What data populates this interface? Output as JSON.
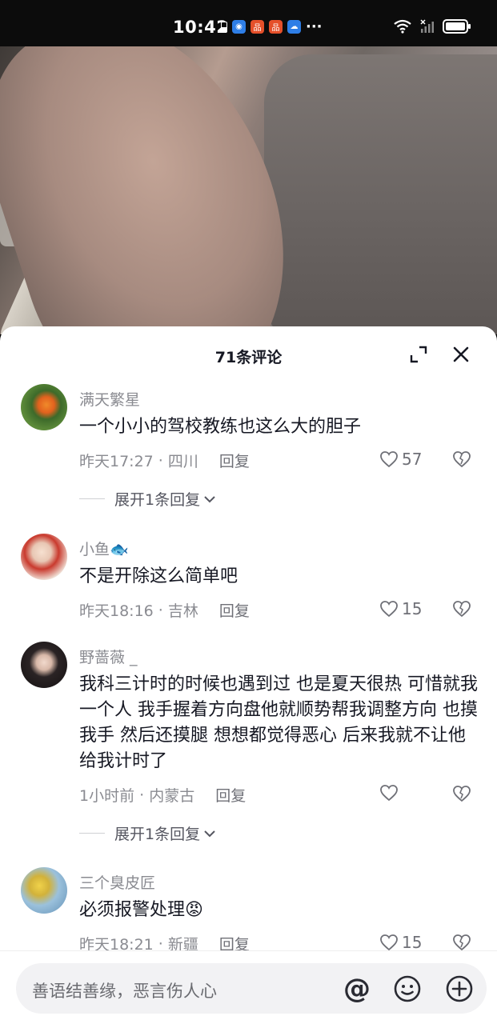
{
  "status_bar": {
    "time": "10:42",
    "more": "···"
  },
  "sheet": {
    "title": "71条评论"
  },
  "comments": [
    {
      "user": "满天繁星",
      "text": "一个小小的驾校教练也这么大的胆子",
      "time": "昨天17:27",
      "location": "四川",
      "reply": "回复",
      "likes": "57",
      "expand": "展开1条回复"
    },
    {
      "user": "小鱼🐟",
      "text": "不是开除这么简单吧",
      "time": "昨天18:16",
      "location": "吉林",
      "reply": "回复",
      "likes": "15"
    },
    {
      "user": "野蔷薇 _",
      "text": "我科三计时的时候也遇到过 也是夏天很热 可惜就我一个人 我手握着方向盘他就顺势帮我调整方向 也摸我手 然后还摸腿 想想都觉得恶心 后来我就不让他给我计时了",
      "time": "1小时前",
      "location": "内蒙古",
      "reply": "回复",
      "likes": "",
      "expand": "展开1条回复"
    },
    {
      "user": "三个臭皮匠",
      "text": "必须报警处理😡",
      "time": "昨天18:21",
      "location": "新疆",
      "reply": "回复",
      "likes": "15"
    }
  ],
  "meta_sep": " · ",
  "input": {
    "placeholder": "善语结善缘，恶言伤人心",
    "at_symbol": "@"
  },
  "colors": {
    "text": "#161823",
    "secondary": "#8a8b91",
    "sheet_bg": "#ffffff"
  }
}
